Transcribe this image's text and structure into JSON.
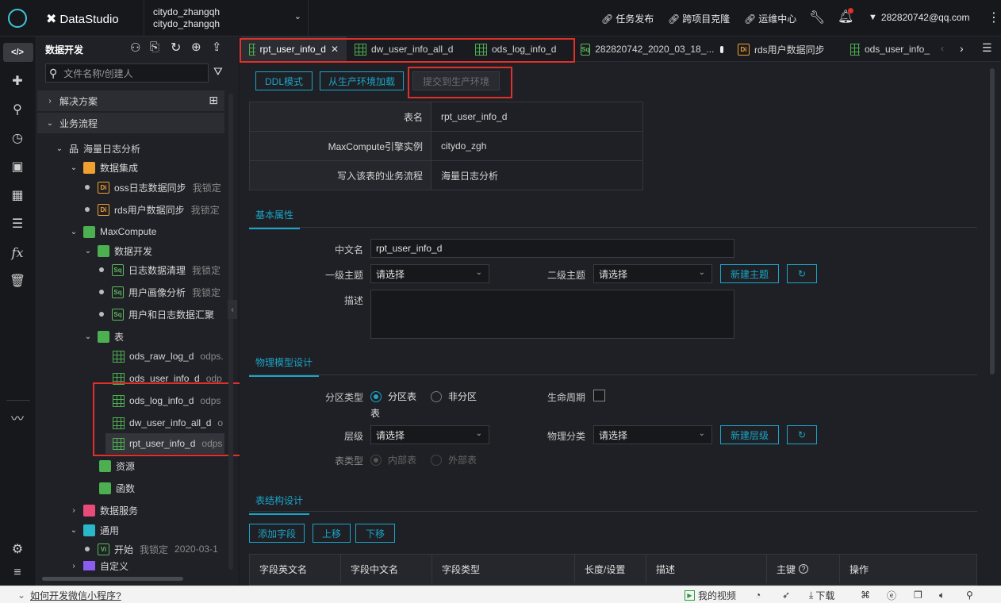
{
  "topbar": {
    "brand": "DataStudio",
    "workspace_line1": "citydo_zhangqh",
    "workspace_line2": "citydo_zhangqh",
    "actions": [
      "任务发布",
      "跨项目克隆",
      "运维中心"
    ],
    "user": "282820742@qq.com"
  },
  "sidebar": {
    "title": "数据开发",
    "search_placeholder": "文件名称/创建人",
    "solution_label": "解决方案",
    "flow_label": "业务流程",
    "workflow_name": "海量日志分析",
    "data_integration": "数据集成",
    "di_items": [
      {
        "name": "oss日志数据同步",
        "meta": "我锁定"
      },
      {
        "name": "rds用户数据同步",
        "meta": "我锁定"
      }
    ],
    "maxcompute": "MaxCompute",
    "data_dev": "数据开发",
    "sq_items": [
      {
        "name": "日志数据清理",
        "meta": "我锁定"
      },
      {
        "name": "用户画像分析",
        "meta": "我锁定"
      },
      {
        "name": "用户和日志数据汇聚",
        "meta": ""
      }
    ],
    "table_folder": "表",
    "tables": [
      {
        "name": "ods_raw_log_d",
        "meta": "odps."
      },
      {
        "name": "ods_user_info_d",
        "meta": "odp"
      },
      {
        "name": "ods_log_info_d",
        "meta": "odps"
      },
      {
        "name": "dw_user_info_all_d",
        "meta": "o"
      },
      {
        "name": "rpt_user_info_d",
        "meta": "odps"
      }
    ],
    "resources": "资源",
    "functions": "函数",
    "data_service": "数据服务",
    "general": "通用",
    "start_item": {
      "name": "开始",
      "meta": "我锁定",
      "date": "2020-03-1"
    },
    "custom": "自定义"
  },
  "tabs": [
    {
      "label": "rpt_user_info_d",
      "icon": "table",
      "active": true,
      "closable": true
    },
    {
      "label": "dw_user_info_all_d",
      "icon": "table"
    },
    {
      "label": "ods_log_info_d",
      "icon": "table"
    },
    {
      "label": "282820742_2020_03_18_...",
      "icon": "sq",
      "dirty": true
    },
    {
      "label": "rds用户数据同步",
      "icon": "di"
    },
    {
      "label": "ods_user_info_",
      "icon": "table"
    }
  ],
  "toolbar": {
    "ddl_mode": "DDL模式",
    "load_from_prod": "从生产环境加载",
    "submit_prod": "提交到生产环境"
  },
  "info": {
    "rows": [
      {
        "label": "表名",
        "value": "rpt_user_info_d"
      },
      {
        "label": "MaxCompute引擎实例",
        "value": "citydo_zgh"
      },
      {
        "label": "写入该表的业务流程",
        "value": "海量日志分析"
      }
    ]
  },
  "basic": {
    "section": "基本属性",
    "cn_name_label": "中文名",
    "cn_name_value": "rpt_user_info_d",
    "topic1_label": "一级主题",
    "topic1_value": "请选择",
    "topic2_label": "二级主题",
    "topic2_value": "请选择",
    "new_topic": "新建主题",
    "desc_label": "描述"
  },
  "physical": {
    "section": "物理模型设计",
    "partition_label": "分区类型",
    "partition_on": "分区表",
    "partition_off": "非分区",
    "partition_on_wrap": "表",
    "lifecycle_label": "生命周期",
    "level_label": "层级",
    "level_value": "请选择",
    "phys_class_label": "物理分类",
    "phys_class_value": "请选择",
    "new_level": "新建层级",
    "table_type_label": "表类型",
    "table_type_internal": "内部表",
    "table_type_external": "外部表"
  },
  "structure": {
    "section": "表结构设计",
    "add_field": "添加字段",
    "move_up": "上移",
    "move_down": "下移",
    "columns": [
      "字段英文名",
      "字段中文名",
      "字段类型",
      "长度/设置",
      "描述",
      "主键",
      "操作"
    ]
  },
  "statusbar": {
    "link": "如何开发微信小程序?",
    "my_video": "我的视频",
    "download": "下载"
  },
  "colors": {
    "accent": "#1aa5c7",
    "highlight": "#e0302a",
    "background": "#1f2025"
  }
}
